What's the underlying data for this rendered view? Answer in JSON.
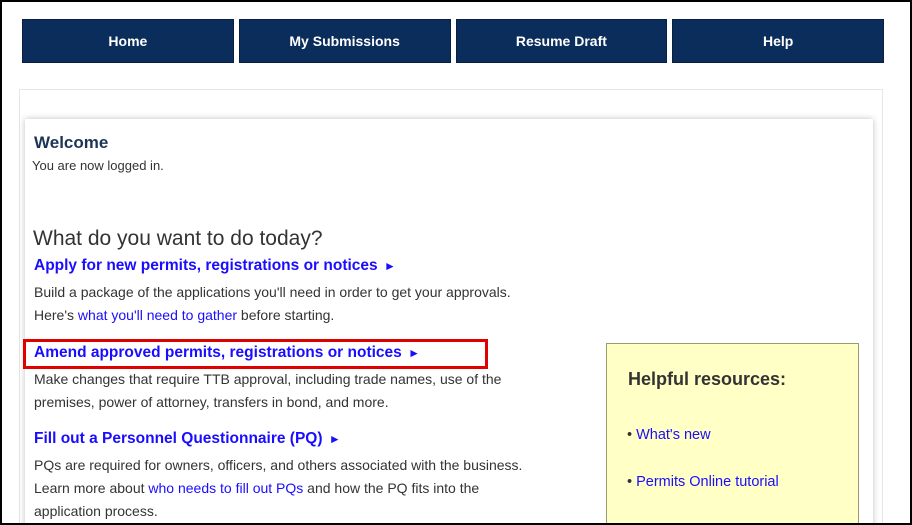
{
  "nav": {
    "items": [
      {
        "label": "Home"
      },
      {
        "label": "My Submissions"
      },
      {
        "label": "Resume Draft"
      },
      {
        "label": "Help"
      }
    ]
  },
  "welcome": {
    "title": "Welcome",
    "subtitle": "You are now logged in."
  },
  "main": {
    "question": "What do you want to do today?",
    "apply": {
      "link": "Apply for new permits, registrations or notices",
      "arrow": "►",
      "desc_line1": "Build a package of the applications you'll need in order to get your approvals.",
      "desc_line2_prefix": "Here's ",
      "desc_line2_link": "what you'll need to gather",
      "desc_line2_suffix": " before starting."
    },
    "amend": {
      "link": "Amend approved permits, registrations or notices",
      "arrow": "►",
      "desc_line1": "Make changes that require TTB approval, including trade names, use of the",
      "desc_line2": "premises, power of attorney, transfers in bond, and more."
    },
    "pq": {
      "link": "Fill out a Personnel Questionnaire (PQ)",
      "arrow": "►",
      "desc_line1": "PQs are required for owners, officers, and others associated with the business.",
      "desc_line2_prefix": "Learn more about ",
      "desc_line2_link": "who needs to fill out PQs",
      "desc_line2_suffix": " and how the PQ fits into the",
      "desc_line3": "application process."
    }
  },
  "resources": {
    "title": "Helpful resources:",
    "items": [
      {
        "bullet": "•",
        "label": "What's new"
      },
      {
        "bullet": "•",
        "label": "Permits Online tutorial"
      }
    ]
  },
  "colors": {
    "nav_bg": "#0b2d5b",
    "link": "#1a0dff",
    "highlight": "#e00000",
    "resources_bg": "#ffffc6"
  }
}
